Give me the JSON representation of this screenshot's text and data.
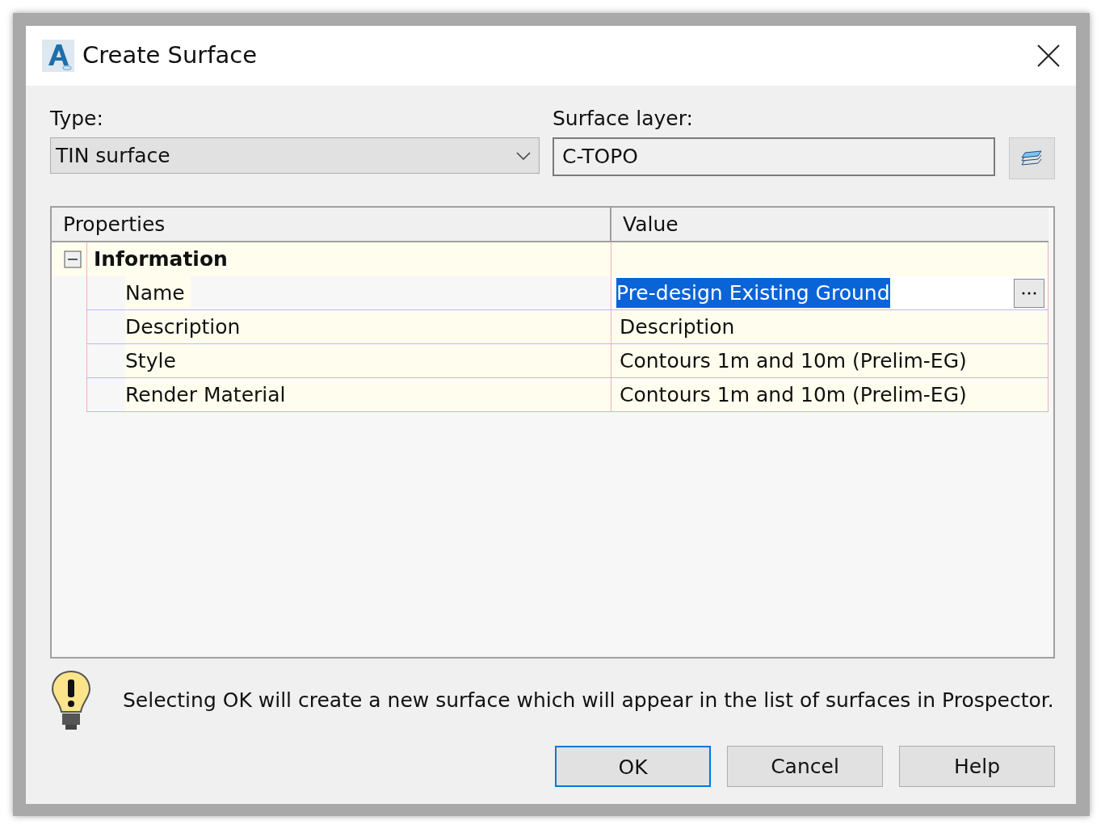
{
  "window": {
    "title": "Create Surface"
  },
  "type_field": {
    "label": "Type:",
    "value": "TIN surface"
  },
  "surface_layer": {
    "label": "Surface layer:",
    "value": "C-TOPO"
  },
  "property_grid": {
    "columns": [
      "Properties",
      "Value"
    ],
    "groups": [
      {
        "name": "Information",
        "expanded": true,
        "properties": [
          {
            "name": "Name",
            "value": "Pre-design Existing Ground",
            "selected": true
          },
          {
            "name": "Description",
            "value": "Description",
            "selected": false
          },
          {
            "name": "Style",
            "value": "Contours 1m and 10m (Prelim-EG)",
            "selected": false
          },
          {
            "name": "Render Material",
            "value": "Contours 1m and 10m (Prelim-EG)",
            "selected": false
          }
        ]
      }
    ]
  },
  "message": "Selecting OK will create a new surface which will appear in the list of surfaces in Prospector.",
  "buttons": [
    {
      "label": "OK",
      "default": true
    },
    {
      "label": "Cancel",
      "default": false
    },
    {
      "label": "Help",
      "default": false
    }
  ]
}
